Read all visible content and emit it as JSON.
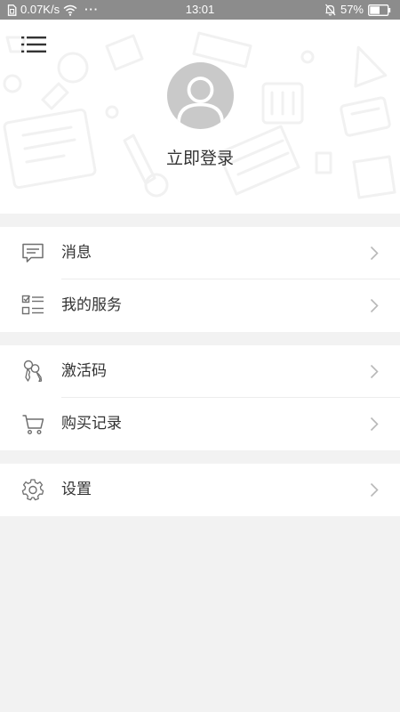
{
  "status_bar": {
    "speed": "0.07K/s",
    "more": "···",
    "time": "13:01",
    "battery": "57%",
    "battery_level": 0.57
  },
  "header": {
    "login_text": "立即登录"
  },
  "menu": {
    "groups": [
      [
        {
          "label": "消息",
          "icon": "message-icon"
        },
        {
          "label": "我的服务",
          "icon": "checklist-icon"
        }
      ],
      [
        {
          "label": "激活码",
          "icon": "keys-icon"
        },
        {
          "label": "购买记录",
          "icon": "cart-icon"
        }
      ],
      [
        {
          "label": "设置",
          "icon": "gear-icon"
        }
      ]
    ]
  },
  "colors": {
    "status_bar_bg": "#8c8c8c",
    "page_bg": "#f2f2f2",
    "avatar_bg": "#c9c9c9",
    "icon_gray": "#6f6f6f",
    "chevron_gray": "#b8b8b8"
  }
}
